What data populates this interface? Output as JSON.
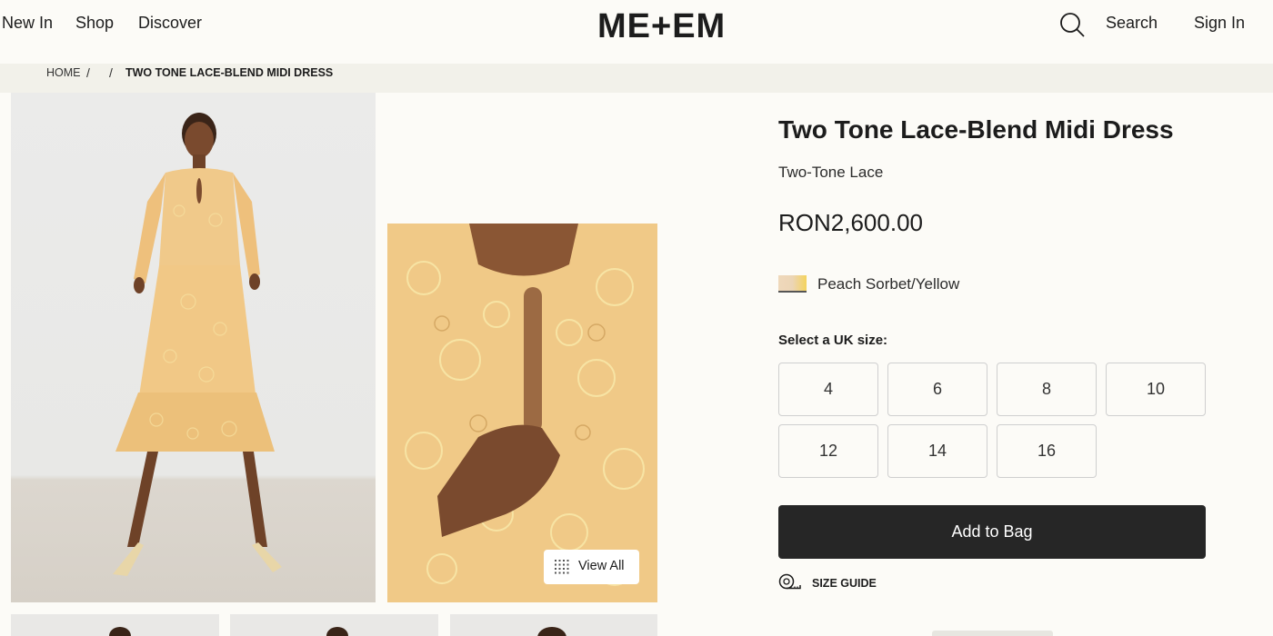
{
  "nav": {
    "new_in": "New In",
    "shop": "Shop",
    "discover": "Discover",
    "logo": "ME+EM",
    "search": "Search",
    "sign_in": "Sign In"
  },
  "breadcrumb": {
    "home": "HOME",
    "current": "TWO TONE LACE-BLEND MIDI DRESS"
  },
  "gallery": {
    "view_all": "View All"
  },
  "product": {
    "title": "Two Tone Lace-Blend Midi Dress",
    "subtitle": "Two-Tone Lace",
    "price": "RON2,600.00",
    "color_name": "Peach Sorbet/Yellow",
    "size_prompt": "Select a UK size:",
    "sizes": [
      "4",
      "6",
      "8",
      "10",
      "12",
      "14",
      "16"
    ],
    "add_to_bag": "Add to Bag",
    "size_guide": "SIZE GUIDE"
  },
  "colors": {
    "background": "#fcfbf7",
    "crumb_bar": "#f2f1ea",
    "button_dark": "#262626",
    "dress_yellow": "#f0c987"
  }
}
